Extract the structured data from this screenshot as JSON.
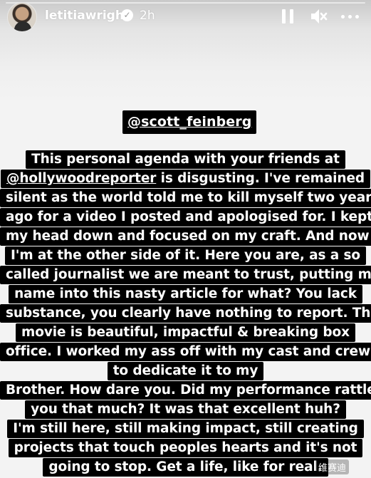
{
  "header": {
    "username": "letitiawright",
    "timestamp": "2h"
  },
  "story": {
    "mention": "@scott_feinberg",
    "lines": [
      "This personal agenda with your friends at",
      "@hollywoodreporter is disgusting. I've remained",
      "silent as the world told me to kill myself two years",
      "ago for a video I posted and apologised for. I kept",
      "my head down and focused on my craft. And now",
      "I'm at the other side of it. Here you are, as a so",
      "called journalist we are meant to trust, putting my",
      "name into this nasty article for what? You lack",
      "substance, you clearly have nothing to report. The",
      "movie is beautiful, impactful & breaking box",
      "office. I worked my ass off with my cast and crew",
      "to dedicate it to my",
      "Brother. How dare you. Did my performance rattle",
      "you that much? It was that excellent huh?",
      "I'm still here, still making impact, still creating",
      "projects that touch peoples hearts and it's not",
      "going to stop. Get a life, like for real."
    ]
  },
  "watermark": "维赛迪",
  "icons": {
    "verified": "verified-badge-icon",
    "pause": "pause-icon",
    "mute": "mute-icon",
    "more": "more-icon"
  }
}
